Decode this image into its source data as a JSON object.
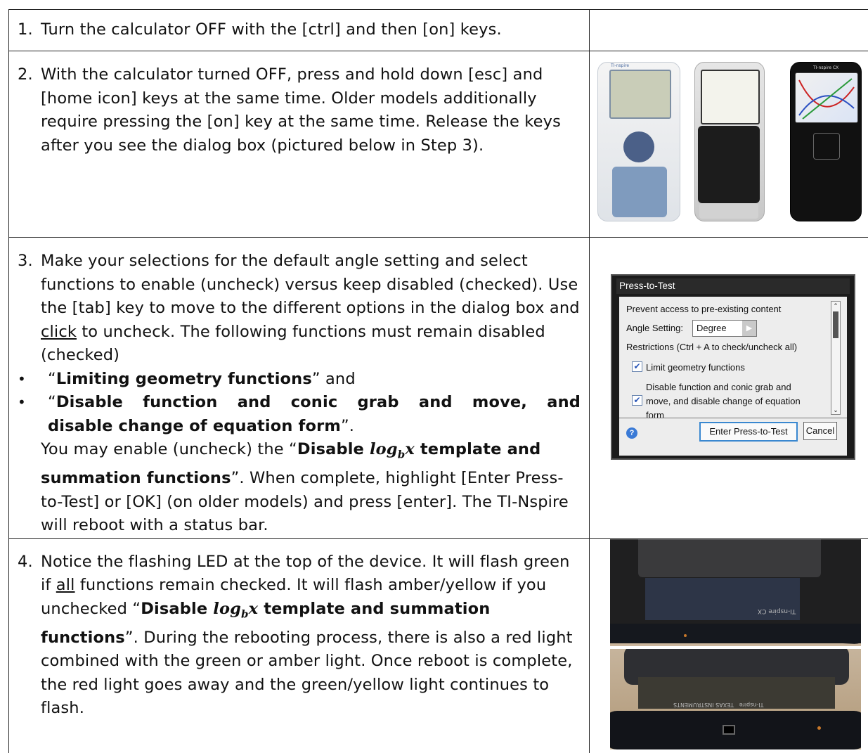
{
  "steps": [
    {
      "num": "1.",
      "text": "Turn the calculator OFF with the [ctrl] and then [on] keys."
    },
    {
      "num": "2.",
      "text": "With the calculator turned OFF, press and hold down [esc] and [home icon] keys at the same time.  Older models additionally require pressing the [on] key at the same time.  Release the keys after you see the dialog box (pictured below in Step 3)."
    },
    {
      "num": "3.",
      "p1_a": "Make your selections for the default angle setting and select functions to enable (uncheck) versus keep disabled (checked). Use the [tab] key to move to the different options in the dialog box and ",
      "p1_link": "click",
      "p1_b": " to uncheck.  The following functions must remain disabled (checked)",
      "bullet1_open": "“",
      "bullet1_bold": "Limiting geometry functions",
      "bullet1_close": "” and",
      "bullet2_open": "“",
      "bullet2_bold_line1": "Disable function and conic grab and move, and",
      "bullet2_bold_line2": "disable change of equation form",
      "bullet2_close": "”.",
      "p2_a": "You may enable (uncheck) the “",
      "p2_bold_a": "Disable ",
      "p2_log": "log",
      "p2_sub": "b",
      "p2_x": "x",
      "p2_bold_b": " template and summation functions",
      "p2_b": "”.  When complete, highlight [Enter Press-to-Test] or [OK] (on older models) and press [enter]. The TI-Nspire will reboot with a status bar."
    },
    {
      "num": "4.",
      "a": "Notice the flashing LED at the top of the device. It will flash green if ",
      "all": "all",
      "b": " functions remain checked.  It will flash amber/yellow if you unchecked “",
      "bold_a": "Disable ",
      "log": "log",
      "sub": "b",
      "x": "x",
      "bold_b": " template and summation functions",
      "c": "”. During the rebooting process, there is also a red light combined with the green or amber light.  Once reboot is complete, the red light goes away and the green/yellow light continues to flash."
    }
  ],
  "calculators": {
    "c1_logo": "TI-nspire",
    "c3_logo": "TI-nspire CX"
  },
  "dialog": {
    "title": "Press-to-Test",
    "prevent": "Prevent access to pre-existing content",
    "angle_label": "Angle Setting:",
    "angle_value": "Degree",
    "restrictions": "Restrictions (Ctrl + A to check/uncheck all)",
    "opt1": "Limit geometry functions",
    "opt2_line1": "Disable function and conic grab and",
    "opt2_line2": "move, and disable change of equation",
    "opt2_line3": "form",
    "help": "?",
    "enter_btn": "Enter Press-to-Test",
    "cancel_btn": "Cancel"
  },
  "photos": {
    "top_label": "TI-nspire CX",
    "bottom_label": "TI-nspire",
    "bottom_brand": "TEXAS INSTRUMENTS"
  },
  "colors": {
    "led_amber": "#c8782a",
    "check_blue": "#2a56b8"
  }
}
